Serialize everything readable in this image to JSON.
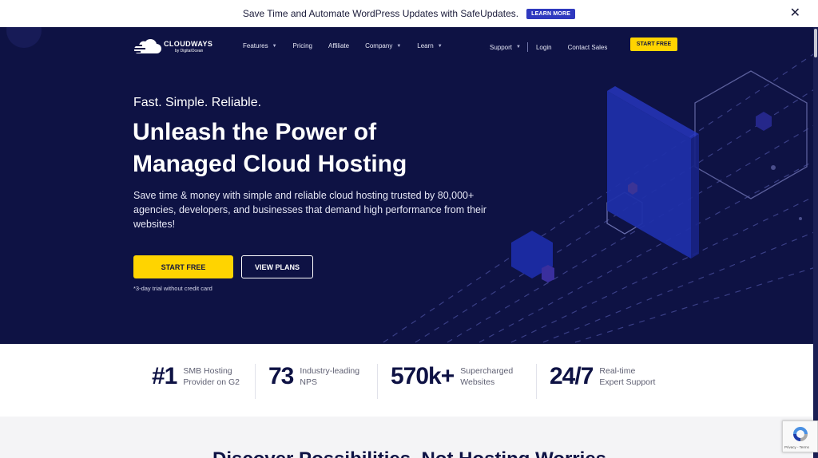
{
  "announcement": {
    "text": "Save Time and Automate WordPress Updates with SafeUpdates.",
    "cta": "LEARN MORE",
    "close": "✕"
  },
  "brand": {
    "name": "CLOUDWAYS",
    "byline": "by DigitalOcean"
  },
  "nav": {
    "left": [
      {
        "label": "Features",
        "dropdown": true
      },
      {
        "label": "Pricing",
        "dropdown": false
      },
      {
        "label": "Affiliate",
        "dropdown": false
      },
      {
        "label": "Company",
        "dropdown": true
      },
      {
        "label": "Learn",
        "dropdown": true
      }
    ],
    "support": "Support",
    "login": "Login",
    "contact": "Contact Sales",
    "start_free": "START FREE",
    "chevron": "▼"
  },
  "hero": {
    "tagline": "Fast. Simple. Reliable.",
    "headline_line1": "Unleash the Power of",
    "headline_line2": "Managed Cloud Hosting",
    "lead": "Save time & money with simple and reliable cloud hosting trusted by 80,000+ agencies, developers, and businesses that demand high performance from their websites!",
    "primary_cta": "START FREE",
    "secondary_cta": "VIEW PLANS",
    "note": "*3-day trial without credit card"
  },
  "stats": [
    {
      "value": "#1",
      "line1": "SMB Hosting",
      "line2": "Provider on G2"
    },
    {
      "value": "73",
      "line1": "Industry-leading",
      "line2": "NPS"
    },
    {
      "value": "570k+",
      "line1": "Supercharged",
      "line2": "Websites"
    },
    {
      "value": "24/7",
      "line1": "Real-time",
      "line2": "Expert Support"
    }
  ],
  "next_section": {
    "heading": "Discover Possibilities, Not Hosting Worries"
  },
  "recaptcha": {
    "links": "Privacy - Terms"
  },
  "colors": {
    "hero_bg": "#0e1244",
    "accent": "#ffd400",
    "learn_more_bg": "#2f39bf"
  }
}
